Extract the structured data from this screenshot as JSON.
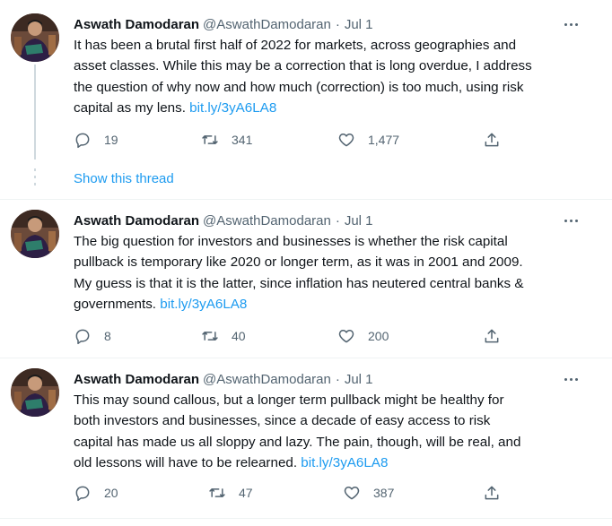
{
  "tweets": [
    {
      "name": "Aswath Damodaran",
      "handle": "@AswathDamodaran",
      "separator": "·",
      "date": "Jul 1",
      "lines": [
        "It has been a brutal first half of 2022 for markets, across geographies and",
        "asset classes. While this may be a correction that is long overdue, I address",
        "the question of why now and how much (correction) is too much, using risk"
      ],
      "last_line_text": "capital as my lens.",
      "link": "bit.ly/3yA6LA8",
      "replies": "19",
      "retweets": "341",
      "likes": "1,477"
    },
    {
      "name": "Aswath Damodaran",
      "handle": "@AswathDamodaran",
      "separator": "·",
      "date": "Jul 1",
      "lines": [
        "The big question for investors and businesses is whether the risk capital",
        "pullback is temporary like 2020 or longer term, as it was in 2001 and 2009.",
        "My guess is that it is the latter, since inflation has neutered central banks &"
      ],
      "last_line_text": "governments.",
      "link": "bit.ly/3yA6LA8",
      "replies": "8",
      "retweets": "40",
      "likes": "200"
    },
    {
      "name": "Aswath Damodaran",
      "handle": "@AswathDamodaran",
      "separator": "·",
      "date": "Jul 1",
      "lines": [
        "This may sound callous, but a longer term pullback might be healthy for",
        "both investors and businesses, since a decade of easy access to risk",
        "capital has made us all sloppy and lazy. The pain, though, will be real, and"
      ],
      "last_line_text": "old lessons will have to be relearned.",
      "link": "bit.ly/3yA6LA8",
      "replies": "20",
      "retweets": "47",
      "likes": "387"
    }
  ],
  "show_thread_label": "Show this thread",
  "icons": {
    "reply": "reply-icon",
    "retweet": "retweet-icon",
    "like": "heart-icon",
    "share": "share-icon",
    "more": "more-options-icon"
  },
  "colors": {
    "link": "#1d9bf0",
    "secondary_text": "#536471",
    "primary_text": "#0f1419",
    "thread_line": "#cfd9de"
  }
}
